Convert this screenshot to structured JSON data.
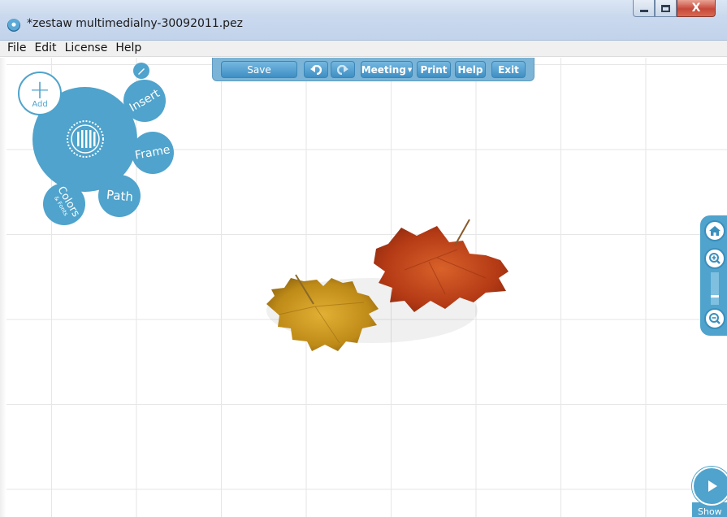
{
  "window": {
    "title": "*zestaw multimedialny-30092011.pez",
    "close_label": "X"
  },
  "menubar": {
    "items": [
      {
        "label": "File"
      },
      {
        "label": "Edit"
      },
      {
        "label": "License"
      },
      {
        "label": "Help"
      }
    ]
  },
  "toolbar": {
    "save_label": "Save",
    "undo_icon": "undo-icon",
    "redo_icon": "redo-icon",
    "meeting_label": "Meeting",
    "print_label": "Print",
    "help_label": "Help",
    "exit_label": "Exit"
  },
  "zebra_menu": {
    "add_label": "Add",
    "insert_label": "Insert",
    "frame_label": "Frame",
    "path_label": "Path",
    "colors_label": "Colors",
    "fonts_label": "& Fonts"
  },
  "zoom_panel": {
    "home_icon": "home-icon",
    "zoom_in_icon": "zoom-in-icon",
    "zoom_out_icon": "zoom-out-icon"
  },
  "show_button": {
    "label": "Show"
  },
  "colors": {
    "accent": "#4fa3cc",
    "toolbar": "#7bb4d6",
    "leaf_orange": "#c4461a",
    "leaf_yellow": "#c9951c"
  }
}
